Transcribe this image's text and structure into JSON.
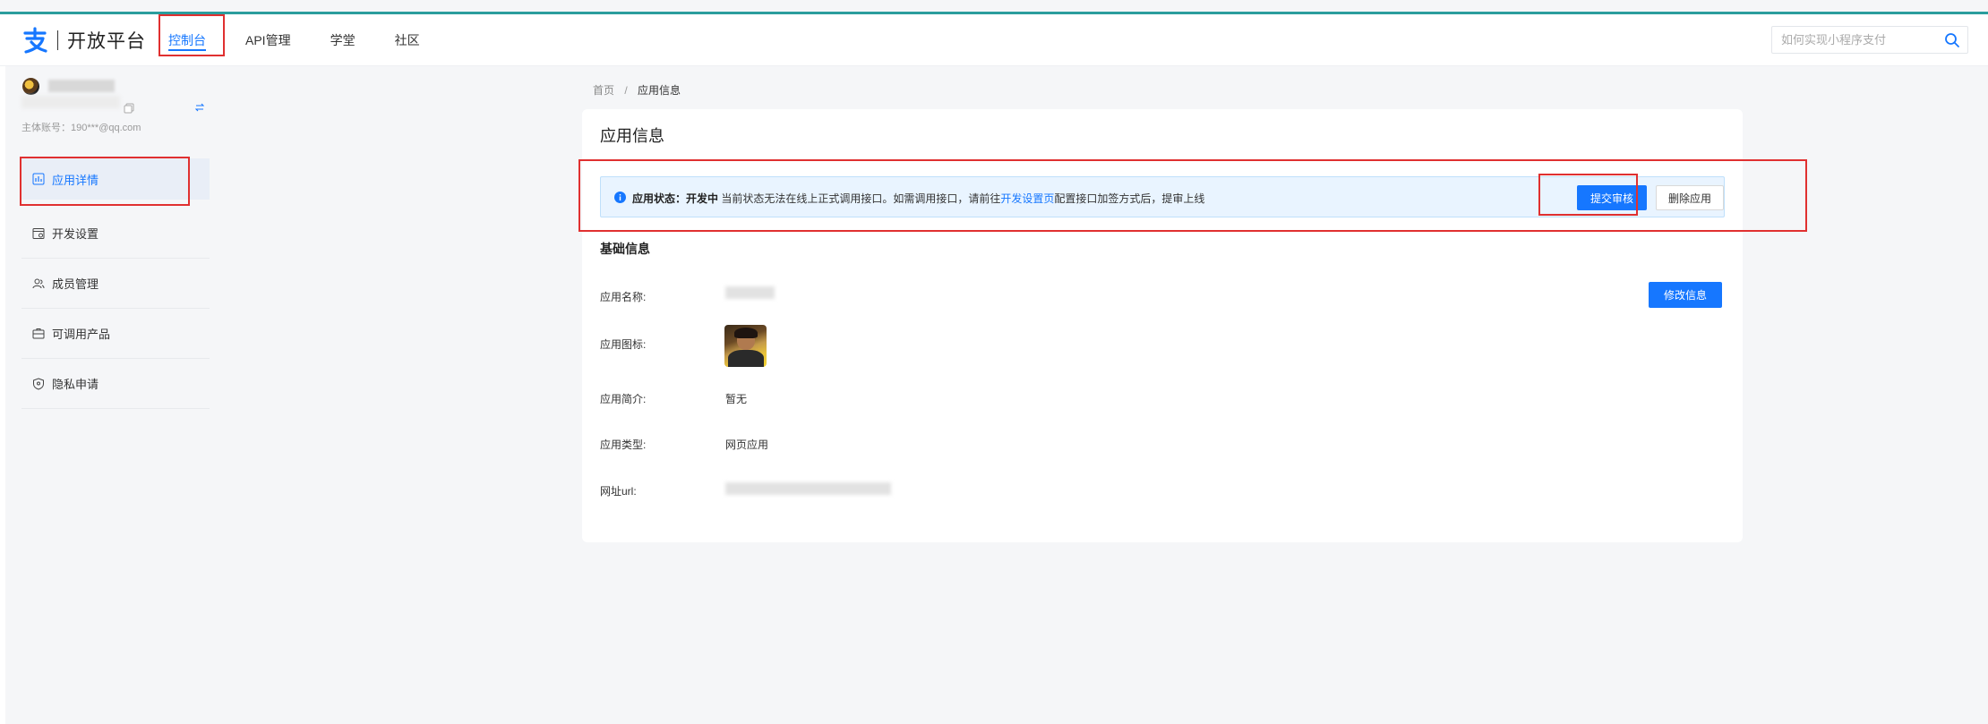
{
  "header": {
    "logo_text": "开放平台",
    "nav": [
      {
        "label": "控制台",
        "active": true
      },
      {
        "label": "API管理",
        "active": false
      },
      {
        "label": "学堂",
        "active": false
      },
      {
        "label": "社区",
        "active": false
      }
    ],
    "search": {
      "placeholder": "如何实现小程序支付",
      "value": ""
    }
  },
  "sidebar": {
    "account_label": "主体账号：190***@qq.com",
    "items": [
      {
        "label": "应用详情",
        "icon": "app-detail-icon",
        "active": true
      },
      {
        "label": "开发设置",
        "icon": "dev-settings-icon",
        "active": false
      },
      {
        "label": "成员管理",
        "icon": "members-icon",
        "active": false
      },
      {
        "label": "可调用产品",
        "icon": "products-icon",
        "active": false
      },
      {
        "label": "隐私申请",
        "icon": "privacy-shield-icon",
        "active": false
      }
    ]
  },
  "breadcrumb": {
    "home": "首页",
    "separator": "/",
    "current": "应用信息"
  },
  "card": {
    "title": "应用信息",
    "alert": {
      "status_label": "应用状态：",
      "status_value": "开发中",
      "message_before": " 当前状态无法在线上正式调用接口。如需调用接口，请前往",
      "link_text": "开发设置页",
      "message_after": "配置接口加签方式后，提审上线",
      "submit_label": "提交审核",
      "delete_label": "删除应用"
    },
    "section_title": "基础信息",
    "edit_label": "修改信息",
    "fields": {
      "name_label": "应用名称:",
      "icon_label": "应用图标:",
      "intro_label": "应用简介:",
      "intro_value": "暂无",
      "type_label": "应用类型:",
      "type_value": "网页应用",
      "url_label": "网址url:"
    }
  },
  "colors": {
    "accent": "#1677ff",
    "highlight_box": "#e03030",
    "top_line": "#2b9d9d",
    "alert_bg": "#e9f4ff"
  }
}
